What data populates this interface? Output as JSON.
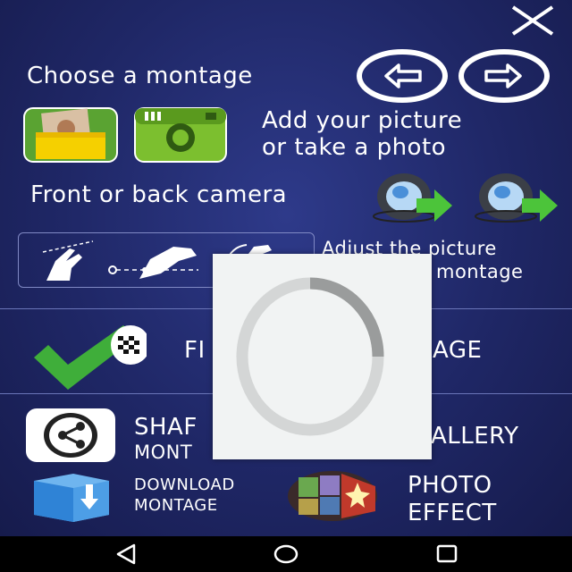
{
  "header": {
    "close_icon": "close-icon",
    "prev_icon": "arrow-left-circle-icon",
    "next_icon": "arrow-right-circle-icon"
  },
  "steps": {
    "choose_montage": "Choose a montage",
    "add_picture_line1": "Add your picture",
    "add_picture_line2": "or take a photo",
    "camera": "Front or back camera",
    "adjust_line1": "Adjust the picture",
    "adjust_line2": "montage"
  },
  "actions": {
    "finish_left": "FI",
    "finish_right": "AGE",
    "share_line1": "SHAF",
    "share_line2": "MONT",
    "gallery": "ALLERY",
    "download_line1": "DOWNLOAD",
    "download_line2": "MONTAGE",
    "photo_effect_line1": "PHOTO",
    "photo_effect_line2": "EFFECT"
  },
  "colors": {
    "background": "#1f2766",
    "divider": "#6a75b8",
    "accent_green": "#3fae3a",
    "spinner_track": "#d4d6d6",
    "spinner_arc": "#9a9c9c"
  },
  "loader": {
    "state": "loading"
  },
  "navbar": {
    "back_icon": "back-triangle-icon",
    "home_icon": "home-circle-icon",
    "recents_icon": "recents-square-icon"
  }
}
